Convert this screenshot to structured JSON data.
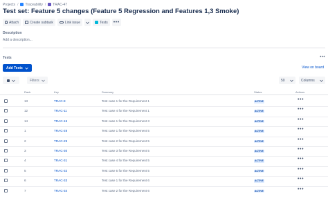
{
  "breadcrumb": [
    {
      "label": "Projects"
    },
    {
      "label": "Traceability"
    },
    {
      "label": "TRAC-47"
    }
  ],
  "title": "Test set: Feature 5 changes (Feature 5 Regression and Features 1,3 Smoke)",
  "toolbar": {
    "attach": "Attach",
    "create_subtask": "Create subtask",
    "link_issue": "Link issue",
    "tests": "Tests",
    "more": "•••"
  },
  "description": {
    "label": "Description",
    "placeholder": "Add a description..."
  },
  "tests_section": {
    "label": "Tests",
    "more": "•••",
    "add_tests": "Add Tests",
    "view_on_board": "View on board",
    "filters": "Filters",
    "page_size": "50",
    "columns": "Columns"
  },
  "table": {
    "columns": [
      "Rank",
      "Key",
      "Summary",
      "Status",
      "Actions"
    ],
    "rows": [
      {
        "rank": "13",
        "key": "TRAC-8",
        "summary": "Test case 1 for the Requirement 1",
        "status": "ACTIVE",
        "actions": "•••"
      },
      {
        "rank": "12",
        "key": "TRAC-11",
        "summary": "Test case 4 for the Requirement 1",
        "status": "ACTIVE",
        "actions": "•••"
      },
      {
        "rank": "14",
        "key": "TRAC-15",
        "summary": "Test case 1 for the Requirement 3",
        "status": "ACTIVE",
        "actions": "•••"
      },
      {
        "rank": "1",
        "key": "TRAC-28",
        "summary": "Test case 1 for the Requirement 5",
        "status": "ACTIVE",
        "actions": "•••"
      },
      {
        "rank": "2",
        "key": "TRAC-29",
        "summary": "Test case 2 for the Requirement 5",
        "status": "ACTIVE",
        "actions": "•••"
      },
      {
        "rank": "3",
        "key": "TRAC-30",
        "summary": "Test case 3 for the Requirement 5",
        "status": "ACTIVE",
        "actions": "•••"
      },
      {
        "rank": "4",
        "key": "TRAC-31",
        "summary": "Test case 4 for the Requirement 5",
        "status": "ACTIVE",
        "actions": "•••"
      },
      {
        "rank": "5",
        "key": "TRAC-32",
        "summary": "Test case 5 for the Requirement 5",
        "status": "ACTIVE",
        "actions": "•••"
      },
      {
        "rank": "6",
        "key": "TRAC-33",
        "summary": "Test case 1 for the Requirement 6",
        "status": "ACTIVE",
        "actions": "•••"
      },
      {
        "rank": "7",
        "key": "TRAC-34",
        "summary": "Test case 2 for the Requirement 6",
        "status": "ACTIVE",
        "actions": "•••"
      }
    ]
  }
}
